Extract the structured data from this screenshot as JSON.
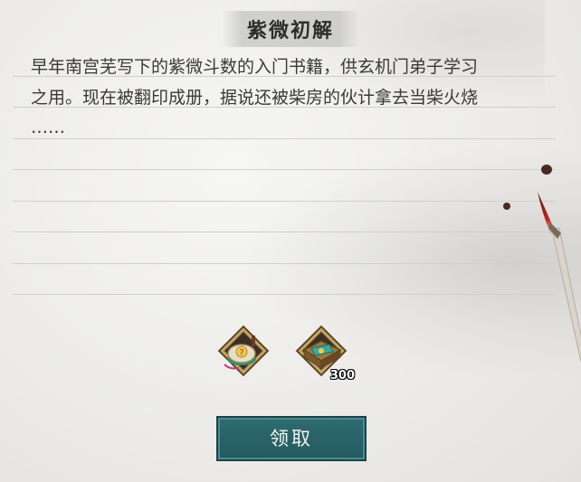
{
  "title": "紫微初解",
  "description": {
    "line1": "早年南宫芜写下的紫微斗数的入门书籍，供玄机门弟子学习",
    "line2": "之用。现在被翻印成册，据说还被柴房的伙计拿去当柴火烧",
    "line3": "……"
  },
  "rewards": [
    {
      "icon": "compass-drum-icon",
      "count": ""
    },
    {
      "icon": "treasure-chest-icon",
      "count": "300"
    }
  ],
  "claim_button": "领取",
  "colors": {
    "button": "#2e6b70",
    "brush_tip": "#a0201a",
    "paper": "#ecebe8"
  }
}
